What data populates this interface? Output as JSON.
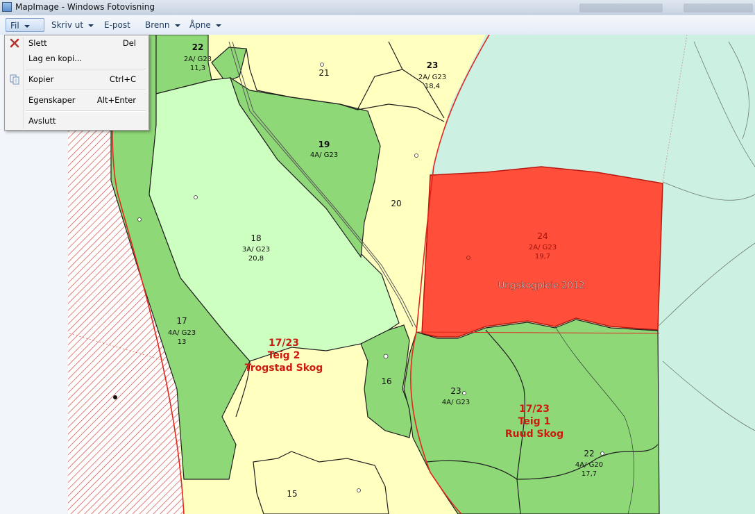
{
  "window": {
    "title": "MapImage - Windows Fotovisning"
  },
  "menubar": {
    "fil": "Fil",
    "skriv_ut": "Skriv ut",
    "epost": "E-post",
    "brenn": "Brenn",
    "apne": "Åpne"
  },
  "file_menu": {
    "slett": {
      "label": "Slett",
      "shortcut": "Del"
    },
    "lag_kopi": {
      "label": "Lag en kopi..."
    },
    "kopier": {
      "label": "Kopier",
      "shortcut": "Ctrl+C"
    },
    "egenskaper": {
      "label": "Egenskaper",
      "shortcut": "Alt+Enter"
    },
    "avslutt": {
      "label": "Avslutt"
    }
  },
  "map": {
    "colors": {
      "light_yellow": "#ffffc0",
      "green": "#8fd878",
      "light_green": "#ccffc0",
      "red_highlight": "#ff4e3a",
      "mint": "#ccf0e2",
      "boundary_red": "#e0281e"
    },
    "stands": [
      {
        "id": "s22_top",
        "number": "22",
        "class": "2A/ G23",
        "age": "11,3"
      },
      {
        "id": "s21",
        "number": "21"
      },
      {
        "id": "s23_top",
        "number": "23",
        "class": "2A/ G23",
        "age": "18,4"
      },
      {
        "id": "s19",
        "number": "19",
        "class": "4A/ G23"
      },
      {
        "id": "s20",
        "number": "20"
      },
      {
        "id": "s18",
        "number": "18",
        "class": "3A/ G23",
        "age": "20,8"
      },
      {
        "id": "s24",
        "number": "24",
        "class": "2A/ G23",
        "age": "19,7",
        "note": "Ungskogpleie 2012"
      },
      {
        "id": "s17",
        "number": "17",
        "class": "4A/ G23",
        "age": "13"
      },
      {
        "id": "s16",
        "number": "16"
      },
      {
        "id": "s23_mid",
        "number": "23",
        "class": "4A/ G23"
      },
      {
        "id": "s22_bottom",
        "number": "22",
        "class": "4A/ G20",
        "age": "17,7"
      },
      {
        "id": "s15",
        "number": "15"
      }
    ],
    "property_labels": {
      "teig2": {
        "number": "17/23",
        "teig": "Teig 2",
        "name": "Trogstad Skog"
      },
      "teig1": {
        "number": "17/23",
        "teig": "Teig 1",
        "name": "Ruud Skog"
      }
    }
  }
}
